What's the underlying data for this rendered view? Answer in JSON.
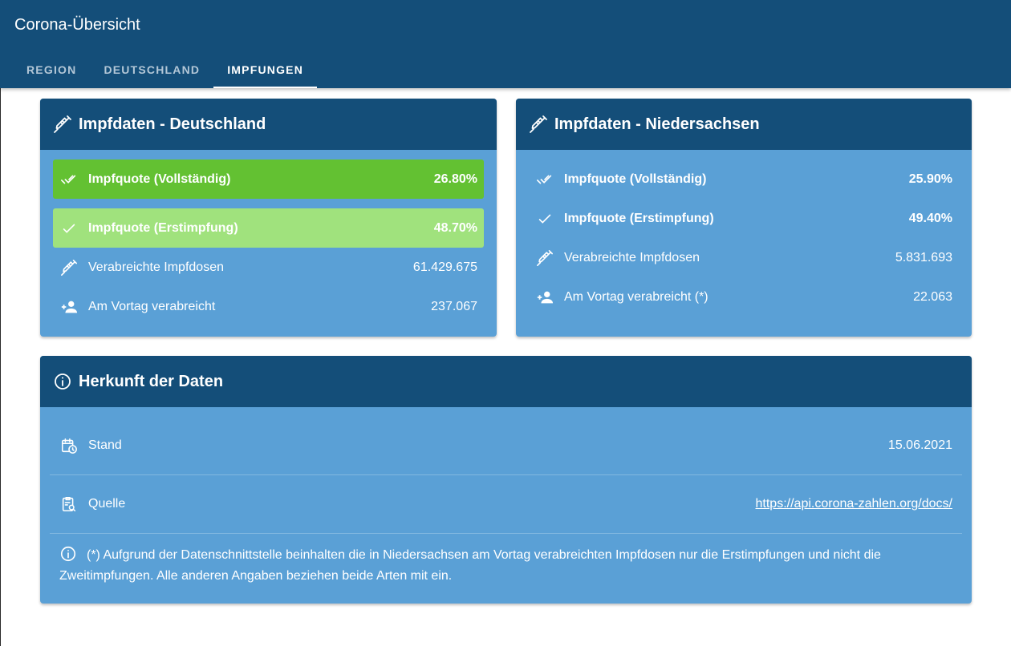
{
  "app": {
    "title": "Corona-Übersicht"
  },
  "tabs": [
    {
      "label": "REGION",
      "active": false
    },
    {
      "label": "DEUTSCHLAND",
      "active": false
    },
    {
      "label": "IMPFUNGEN",
      "active": true
    }
  ],
  "colors": {
    "primary": "#144e79",
    "card_body": "#5aa0d6",
    "green_full": "#63c132",
    "green_first": "#a0e27d"
  },
  "card_de": {
    "title": "Impfdaten - Deutschland",
    "icon": "syringe-icon",
    "rows": [
      {
        "icon": "double-check-icon",
        "label": "Impfquote (Vollständig)",
        "value": "26.80%"
      },
      {
        "icon": "check-icon",
        "label": "Impfquote (Erstimpfung)",
        "value": "48.70%"
      },
      {
        "icon": "syringe-icon",
        "label": "Verabreichte Impfdosen",
        "value": "61.429.675"
      },
      {
        "icon": "person-add-icon",
        "label": "Am Vortag verabreicht",
        "value": "237.067"
      }
    ]
  },
  "card_ns": {
    "title": "Impfdaten - Niedersachsen",
    "icon": "syringe-icon",
    "rows": [
      {
        "icon": "double-check-icon",
        "label": "Impfquote (Vollständig)",
        "value": "25.90%"
      },
      {
        "icon": "check-icon",
        "label": "Impfquote (Erstimpfung)",
        "value": "49.40%"
      },
      {
        "icon": "syringe-icon",
        "label": "Verabreichte Impfdosen",
        "value": "5.831.693"
      },
      {
        "icon": "person-add-icon",
        "label": "Am Vortag verabreicht (*)",
        "value": "22.063"
      }
    ]
  },
  "info": {
    "title": "Herkunft der Daten",
    "icon": "info-icon",
    "stand_label": "Stand",
    "stand_value": "15.06.2021",
    "quelle_label": "Quelle",
    "quelle_value": "https://api.corona-zahlen.org/docs/",
    "note": "(*) Aufgrund der Datenschnittstelle beinhalten die in Niedersachsen am Vortag verabreichten Impfdosen nur die Erstimpfungen und nicht die Zweitimpfungen. Alle anderen Angaben beziehen beide Arten mit ein."
  }
}
